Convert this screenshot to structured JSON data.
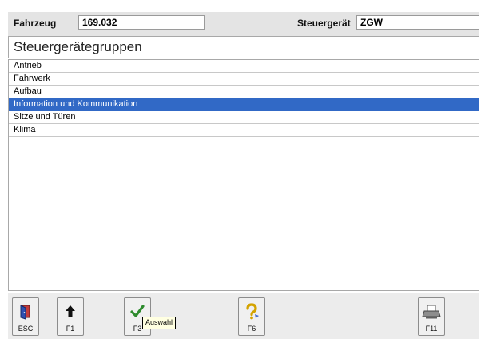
{
  "header": {
    "vehicle_label": "Fahrzeug",
    "vehicle_value": "169.032",
    "control_unit_label": "Steuergerät",
    "control_unit_value": "ZGW"
  },
  "panel": {
    "title": "Steuergerätegruppen"
  },
  "list": {
    "items": [
      "Antrieb",
      "Fahrwerk",
      "Aufbau",
      "Information und Kommunikation",
      "Sitze und Türen",
      "Klima"
    ],
    "selected_index": 3
  },
  "footer": {
    "buttons": [
      {
        "key": "ESC",
        "icon": "exit-door-icon"
      },
      {
        "key": "F1",
        "icon": "arrow-up-icon"
      },
      {
        "key": "F3",
        "icon": "checkmark-icon"
      },
      {
        "key": "F6",
        "icon": "help-question-icon"
      },
      {
        "key": "F11",
        "icon": "printer-icon"
      }
    ],
    "tooltip": "Auswahl"
  },
  "colors": {
    "selection": "#3169c6",
    "header_bg": "#e4e4e4",
    "footer_bg": "#ececec",
    "checkmark": "#2e8b2e"
  }
}
